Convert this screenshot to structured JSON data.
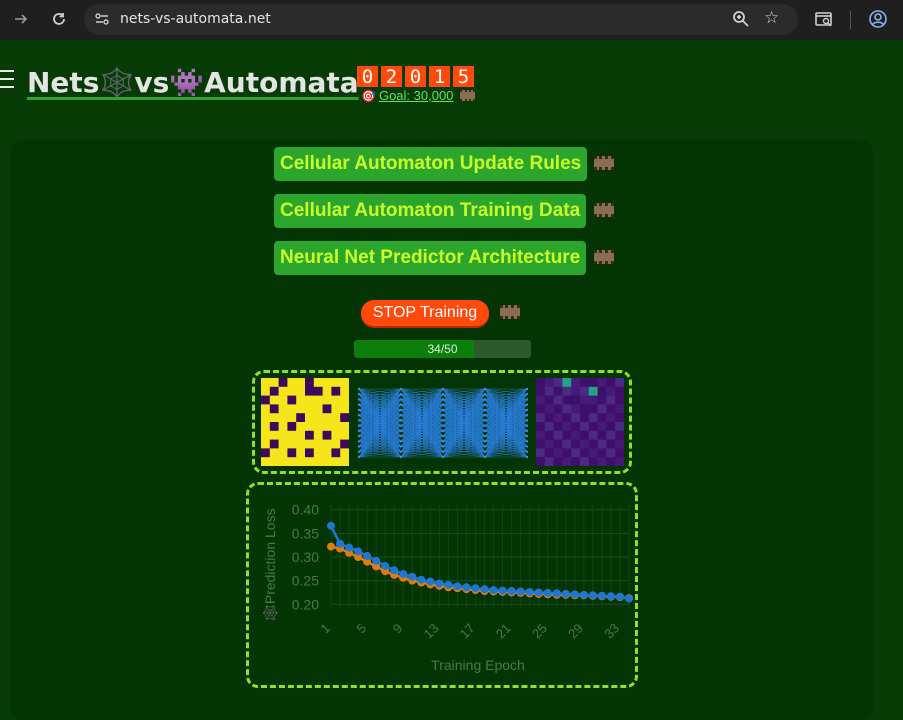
{
  "browser": {
    "url": "nets-vs-automata.net"
  },
  "site": {
    "title": "Nets🕸️vs👾Automata",
    "counter_digits": [
      "0",
      "2",
      "0",
      "1",
      "5"
    ],
    "goal_label": "Goal: 30,000"
  },
  "sections": [
    {
      "label": "Cellular Automaton Update Rules"
    },
    {
      "label": "Cellular Automaton Training Data"
    },
    {
      "label": "Neural Net Predictor Architecture"
    }
  ],
  "training": {
    "stop_label": "STOP Training",
    "progress_text": "34/50",
    "progress_fraction": 0.68
  },
  "colors": {
    "accent_green": "#2ca52c",
    "label_lime": "#c8ff2a",
    "stop_orange": "#ff4a0e",
    "series_blue": "#1f77d4",
    "series_orange": "#e07b10"
  },
  "automaton_grid": [
    [
      0,
      0,
      1,
      0,
      0,
      1,
      0,
      0,
      0,
      0
    ],
    [
      0,
      1,
      0,
      0,
      0,
      1,
      1,
      0,
      1,
      0
    ],
    [
      1,
      0,
      0,
      1,
      0,
      0,
      0,
      0,
      0,
      0
    ],
    [
      0,
      1,
      0,
      0,
      0,
      0,
      0,
      1,
      0,
      0
    ],
    [
      0,
      0,
      0,
      0,
      1,
      0,
      0,
      0,
      0,
      1
    ],
    [
      0,
      1,
      0,
      1,
      0,
      0,
      0,
      0,
      0,
      0
    ],
    [
      0,
      0,
      0,
      0,
      0,
      1,
      0,
      1,
      0,
      0
    ],
    [
      0,
      1,
      0,
      0,
      0,
      0,
      0,
      0,
      0,
      1
    ],
    [
      1,
      0,
      0,
      1,
      0,
      1,
      0,
      0,
      1,
      0
    ],
    [
      0,
      0,
      0,
      0,
      0,
      0,
      0,
      0,
      0,
      0
    ]
  ],
  "prediction_grid": [
    [
      0.2,
      0.25,
      0.35,
      0.6,
      0.25,
      0.2,
      0.2,
      0.25,
      0.2,
      0.3
    ],
    [
      0.2,
      0.3,
      0.2,
      0.35,
      0.25,
      0.3,
      0.65,
      0.2,
      0.25,
      0.2
    ],
    [
      0.25,
      0.2,
      0.3,
      0.2,
      0.2,
      0.25,
      0.25,
      0.2,
      0.3,
      0.2
    ],
    [
      0.2,
      0.25,
      0.2,
      0.3,
      0.25,
      0.2,
      0.2,
      0.3,
      0.2,
      0.25
    ],
    [
      0.3,
      0.2,
      0.25,
      0.2,
      0.35,
      0.2,
      0.3,
      0.2,
      0.25,
      0.2
    ],
    [
      0.2,
      0.3,
      0.2,
      0.25,
      0.2,
      0.3,
      0.2,
      0.25,
      0.2,
      0.3
    ],
    [
      0.25,
      0.2,
      0.3,
      0.2,
      0.25,
      0.2,
      0.3,
      0.2,
      0.3,
      0.2
    ],
    [
      0.2,
      0.25,
      0.2,
      0.3,
      0.2,
      0.25,
      0.2,
      0.3,
      0.2,
      0.25
    ],
    [
      0.3,
      0.2,
      0.25,
      0.2,
      0.3,
      0.2,
      0.25,
      0.2,
      0.3,
      0.2
    ],
    [
      0.2,
      0.3,
      0.2,
      0.25,
      0.2,
      0.3,
      0.2,
      0.25,
      0.2,
      0.25
    ]
  ],
  "chart_data": {
    "type": "line",
    "title": "",
    "xlabel": "Training Epoch",
    "ylabel": "🕸️Prediction Loss",
    "xlim": [
      1,
      34
    ],
    "ylim": [
      0.19,
      0.41
    ],
    "x_ticks": [
      1,
      5,
      9,
      13,
      17,
      21,
      25,
      29,
      33
    ],
    "y_ticks": [
      0.2,
      0.25,
      0.3,
      0.35,
      0.4
    ],
    "grid": true,
    "x": [
      1,
      2,
      3,
      4,
      5,
      6,
      7,
      8,
      9,
      10,
      11,
      12,
      13,
      14,
      15,
      16,
      17,
      18,
      19,
      20,
      21,
      22,
      23,
      24,
      25,
      26,
      27,
      28,
      29,
      30,
      31,
      32,
      33,
      34
    ],
    "series": [
      {
        "color": "#e07b10",
        "values": [
          0.322,
          0.318,
          0.309,
          0.3,
          0.29,
          0.28,
          0.27,
          0.262,
          0.256,
          0.25,
          0.246,
          0.242,
          0.239,
          0.236,
          0.234,
          0.232,
          0.23,
          0.228,
          0.227,
          0.226,
          0.225,
          0.224,
          0.223,
          0.222,
          0.221,
          0.22,
          0.22,
          0.219,
          0.219,
          0.218,
          0.217,
          0.216,
          0.215,
          0.213
        ]
      },
      {
        "color": "#1f77d4",
        "values": [
          0.366,
          0.328,
          0.32,
          0.312,
          0.302,
          0.292,
          0.281,
          0.272,
          0.264,
          0.258,
          0.252,
          0.248,
          0.244,
          0.241,
          0.238,
          0.236,
          0.234,
          0.232,
          0.23,
          0.229,
          0.228,
          0.227,
          0.226,
          0.225,
          0.224,
          0.223,
          0.222,
          0.221,
          0.22,
          0.219,
          0.218,
          0.217,
          0.216,
          0.212
        ]
      }
    ]
  }
}
